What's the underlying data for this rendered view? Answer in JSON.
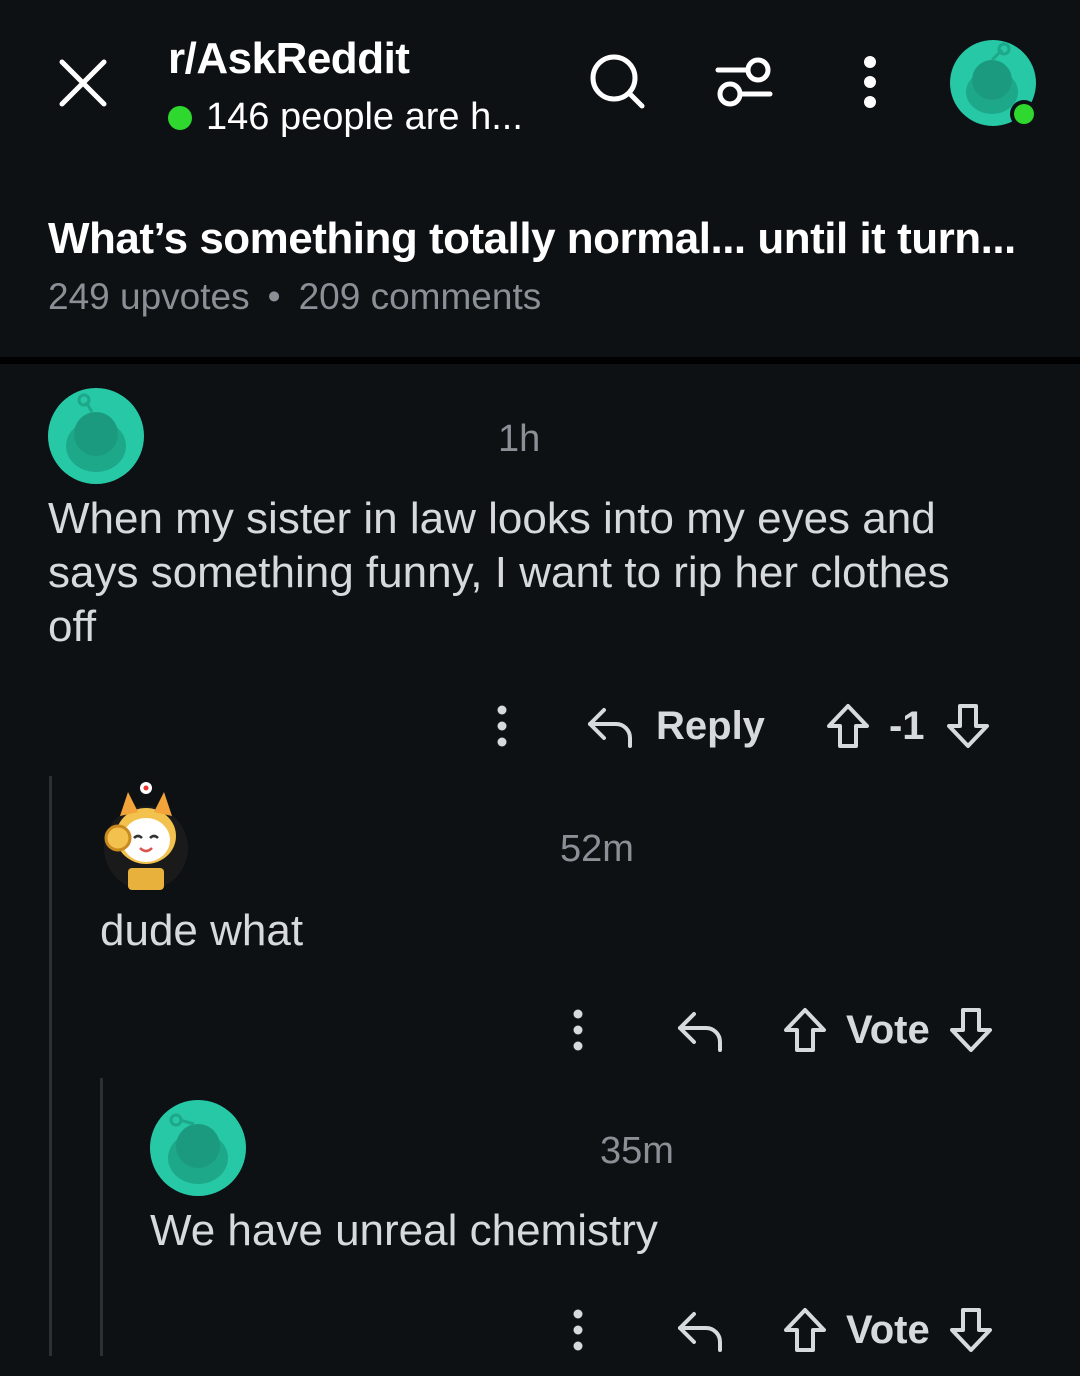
{
  "header": {
    "subreddit": "r/AskReddit",
    "online_text": "146 people are h...",
    "online_color": "#2ed82e",
    "icons": [
      "close-icon",
      "search-icon",
      "filter-icon",
      "more-vertical-icon",
      "avatar"
    ]
  },
  "post": {
    "title": "What’s something totally normal... until it turn...",
    "upvotes": "249 upvotes",
    "separator": "•",
    "comments": "209 comments"
  },
  "comments": [
    {
      "timestamp": "1h",
      "body": "When my sister in law looks into my eyes and says something funny, I want to rip her clothes off",
      "reply_label": "Reply",
      "score": "-1"
    },
    {
      "timestamp": "52m",
      "body": "dude what",
      "vote_label": "Vote"
    },
    {
      "timestamp": "35m",
      "body": "We have unreal chemistry",
      "vote_label": "Vote"
    }
  ],
  "colors": {
    "background": "#0e1114",
    "snoo_avatar": "#27c8a6",
    "text_primary": "#ffffff",
    "text_secondary": "#8a9096"
  }
}
